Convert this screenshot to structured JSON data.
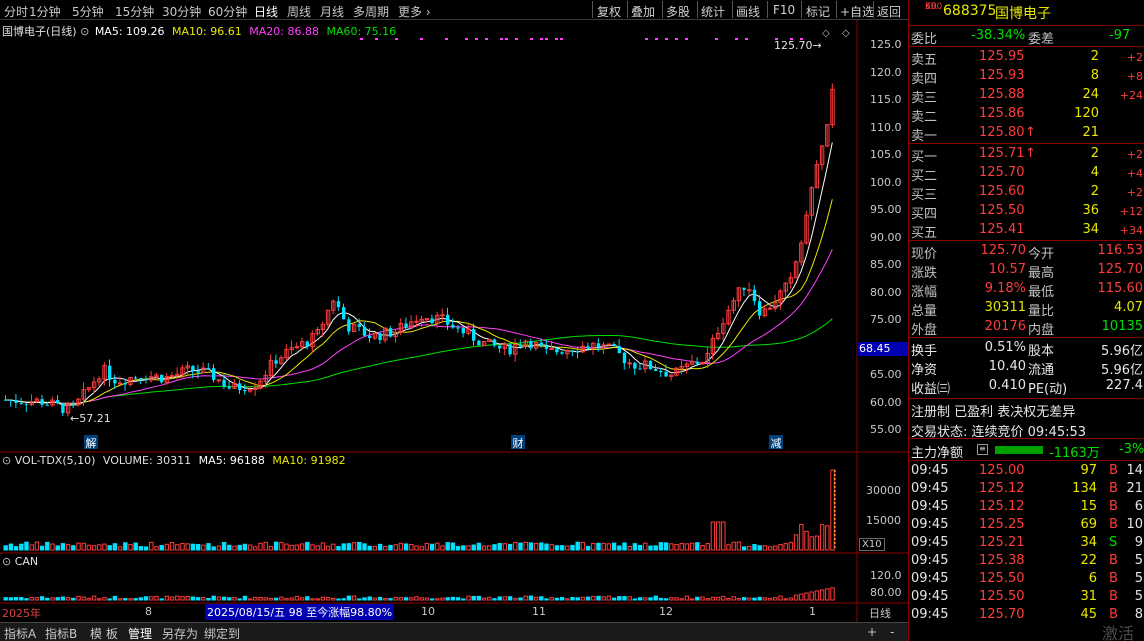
{
  "toolbar": {
    "periods": [
      "分时",
      "1分钟",
      "5分钟",
      "15分钟",
      "30分钟",
      "60分钟",
      "日线",
      "周线",
      "月线",
      "多周期",
      "更多"
    ],
    "active_period": "日线",
    "more_arrow": "›",
    "tools": [
      "复权",
      "叠加",
      "多股",
      "统计",
      "画线",
      "F10",
      "标记",
      "+自选",
      "返回"
    ]
  },
  "chart": {
    "stock_label": "国博电子(日线)",
    "ma5": "MA5: 109.26",
    "ma10": "MA10: 96.61",
    "ma20": "MA20: 86.88",
    "ma60": "MA60: 75.16",
    "high_marker": "125.70",
    "low_marker": "57.21",
    "current_price_tag": "68.45",
    "price_ticks": [
      "125.0",
      "120.0",
      "115.0",
      "110.0",
      "105.0",
      "100.0",
      "95.00",
      "90.00",
      "85.00",
      "80.00",
      "75.00",
      "70.00",
      "65.00",
      "60.00",
      "55.00"
    ],
    "event_markers": [
      "解",
      "财",
      "减"
    ],
    "colors": {
      "up": "#ff3c3c",
      "down": "#00e0ff",
      "ma5": "#ffffff",
      "ma10": "#e8e800",
      "ma20": "#ff40ff",
      "ma60": "#00e000",
      "tag": "#0000b0"
    }
  },
  "volume": {
    "indicator": "VOL-TDX(5,10)",
    "volume": "VOLUME: 30311",
    "ma5": "MA5: 96188",
    "ma10": "MA10: 91982",
    "ticks": [
      "30000",
      "15000"
    ],
    "unit": "X10"
  },
  "can": {
    "indicator": "CAN",
    "ticks": [
      "120.0",
      "80.00"
    ]
  },
  "timeline": {
    "year": "2025年",
    "months": [
      "8",
      "10",
      "11",
      "12",
      "1"
    ],
    "hover_info": "2025/08/15/五 98 至今涨幅98.80%",
    "period_label": "日线"
  },
  "bottom_tabs": [
    "指标A",
    "指标B",
    "模 板",
    "管理",
    "另存为",
    "绑定到"
  ],
  "bottom_controls": [
    "+",
    "-"
  ],
  "panel": {
    "badge_top": "KR",
    "badge_bottom": "500",
    "code": "688375",
    "name": "国博电子",
    "weibi_label": "委比",
    "weibi_value": "-38.34%",
    "weicha_label": "委差",
    "weicha_value": "-97",
    "asks": [
      {
        "label": "卖五",
        "price": "125.95",
        "vol": "2",
        "chg": "+2"
      },
      {
        "label": "卖四",
        "price": "125.93",
        "vol": "8",
        "chg": "+8"
      },
      {
        "label": "卖三",
        "price": "125.88",
        "vol": "24",
        "chg": "+24"
      },
      {
        "label": "卖二",
        "price": "125.86",
        "vol": "120",
        "chg": ""
      },
      {
        "label": "卖一",
        "price": "125.80",
        "vol": "21",
        "chg": "",
        "arrow": "↑"
      }
    ],
    "bids": [
      {
        "label": "买一",
        "price": "125.71",
        "vol": "2",
        "chg": "+2",
        "arrow": "↑"
      },
      {
        "label": "买二",
        "price": "125.70",
        "vol": "4",
        "chg": "+4"
      },
      {
        "label": "买三",
        "price": "125.60",
        "vol": "2",
        "chg": "+2"
      },
      {
        "label": "买四",
        "price": "125.50",
        "vol": "36",
        "chg": "+12"
      },
      {
        "label": "买五",
        "price": "125.41",
        "vol": "34",
        "chg": "+34"
      }
    ],
    "quote": [
      {
        "l1": "现价",
        "v1": "125.70",
        "l2": "今开",
        "v2": "116.53"
      },
      {
        "l1": "涨跌",
        "v1": "10.57",
        "l2": "最高",
        "v2": "125.70"
      },
      {
        "l1": "涨幅",
        "v1": "9.18%",
        "l2": "最低",
        "v2": "115.60"
      },
      {
        "l1": "总量",
        "v1": "30311",
        "l2": "量比",
        "v2": "4.07"
      },
      {
        "l1": "外盘",
        "v1": "20176",
        "l2": "内盘",
        "v2": "10135"
      }
    ],
    "stats": [
      {
        "l1": "换手",
        "v1": "0.51%",
        "l2": "股本",
        "v2": "5.96亿"
      },
      {
        "l1": "净资",
        "v1": "10.40",
        "l2": "流通",
        "v2": "5.96亿"
      },
      {
        "l1": "收益㈢",
        "v1": "0.410",
        "l2": "PE(动)",
        "v2": "227.4"
      }
    ],
    "tags": "注册制 已盈利 表决权无差异",
    "trade_status": "交易状态: 连续竞价 09:45:53",
    "main_flow_label": "主力净额",
    "main_flow_value": "-1163万",
    "main_flow_pct": "-3%",
    "ticks": [
      {
        "time": "09:45",
        "price": "125.00",
        "vol": "97",
        "side": "B",
        "n": "14"
      },
      {
        "time": "09:45",
        "price": "125.12",
        "vol": "134",
        "side": "B",
        "n": "21"
      },
      {
        "time": "09:45",
        "price": "125.12",
        "vol": "15",
        "side": "B",
        "n": "6"
      },
      {
        "time": "09:45",
        "price": "125.25",
        "vol": "69",
        "side": "B",
        "n": "10"
      },
      {
        "time": "09:45",
        "price": "125.21",
        "vol": "34",
        "side": "S",
        "n": "9"
      },
      {
        "time": "09:45",
        "price": "125.38",
        "vol": "22",
        "side": "B",
        "n": "5"
      },
      {
        "time": "09:45",
        "price": "125.50",
        "vol": "6",
        "side": "B",
        "n": "5"
      },
      {
        "time": "09:45",
        "price": "125.50",
        "vol": "31",
        "side": "B",
        "n": "5"
      },
      {
        "time": "09:45",
        "price": "125.70",
        "vol": "45",
        "side": "B",
        "n": "8"
      }
    ],
    "watermark": "激活"
  }
}
